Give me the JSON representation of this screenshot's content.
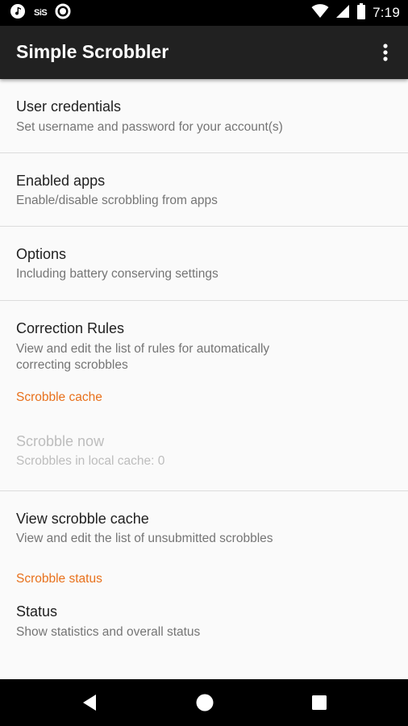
{
  "status_bar": {
    "time": "7:19",
    "left_icons": [
      "music-note-icon",
      "sys-icon",
      "circle-icon"
    ],
    "sys_text": "SiS",
    "right_icons": [
      "wifi-icon",
      "signal-icon",
      "battery-icon"
    ]
  },
  "app_bar": {
    "title": "Simple Scrobbler",
    "overflow_icon": "more-vert-icon",
    "background": "#212121"
  },
  "preferences": [
    {
      "title": "User credentials",
      "subtitle": "Set username and password for your account(s)"
    },
    {
      "title": "Enabled apps",
      "subtitle": "Enable/disable scrobbling from apps"
    },
    {
      "title": "Options",
      "subtitle": "Including battery conserving settings"
    },
    {
      "title": "Correction Rules",
      "subtitle": "View and edit the list of rules for automatically correcting scrobbles"
    }
  ],
  "categories": {
    "cache": {
      "title": "Scrobble cache",
      "items": [
        {
          "title": "Scrobble now",
          "subtitle": "Scrobbles in local cache: 0",
          "enabled": false
        },
        {
          "title": "View scrobble cache",
          "subtitle": "View and edit the list of unsubmitted scrobbles",
          "enabled": true
        }
      ]
    },
    "status": {
      "title": "Scrobble status",
      "items": [
        {
          "title": "Status",
          "subtitle": "Show statistics and overall status",
          "enabled": true
        }
      ]
    }
  },
  "accent_color": "#e8711c",
  "nav_bar": {
    "icons": [
      "back-icon",
      "home-icon",
      "recents-icon"
    ]
  }
}
